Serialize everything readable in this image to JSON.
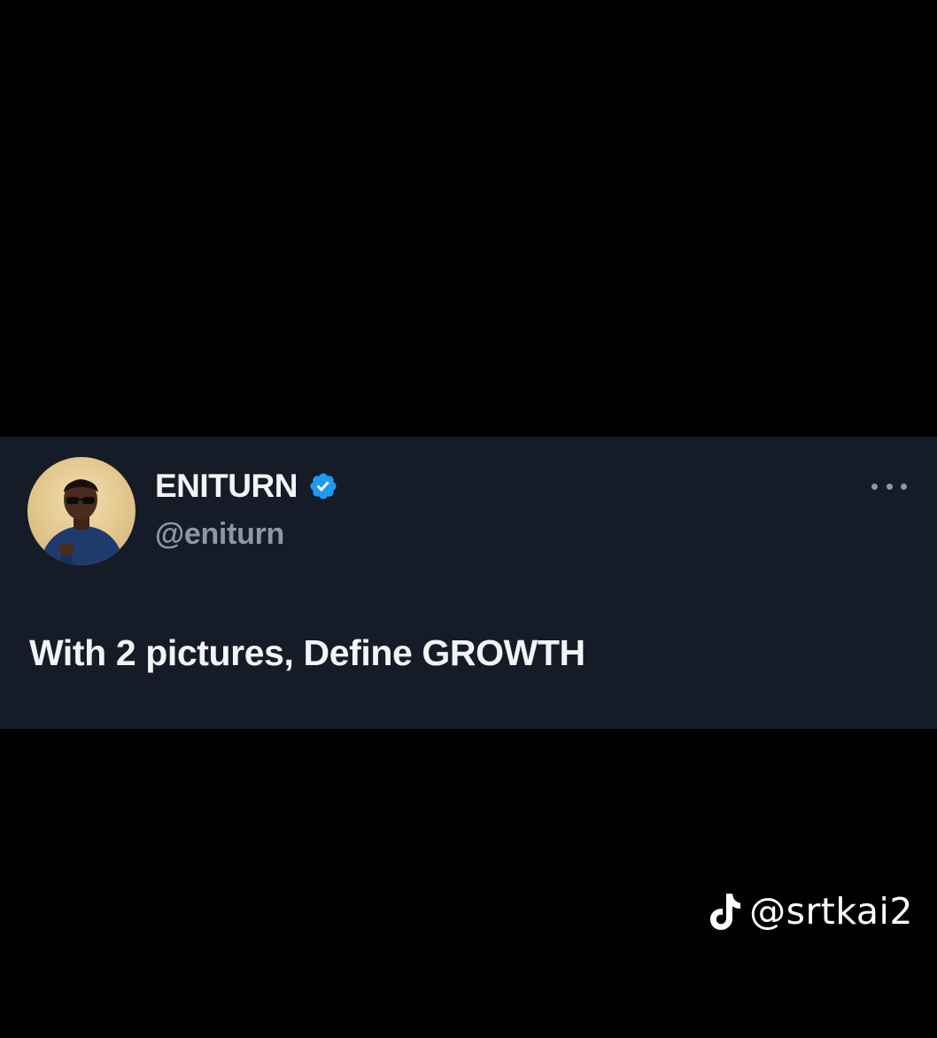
{
  "tweet": {
    "display_name": "ENITURN",
    "handle": "@eniturn",
    "verified": true,
    "text": "With 2 pictures, Define GROWTH",
    "avatar_icon": "user-avatar-photo",
    "more_icon": "more-horizontal-icon"
  },
  "watermark": {
    "platform_icon": "tiktok-logo-icon",
    "handle": "@srtkai2"
  },
  "colors": {
    "background": "#000000",
    "card": "#151c28",
    "primary_text": "#f2f4f6",
    "secondary_text": "#8b98a5",
    "verified_blue": "#1d9bf0"
  }
}
